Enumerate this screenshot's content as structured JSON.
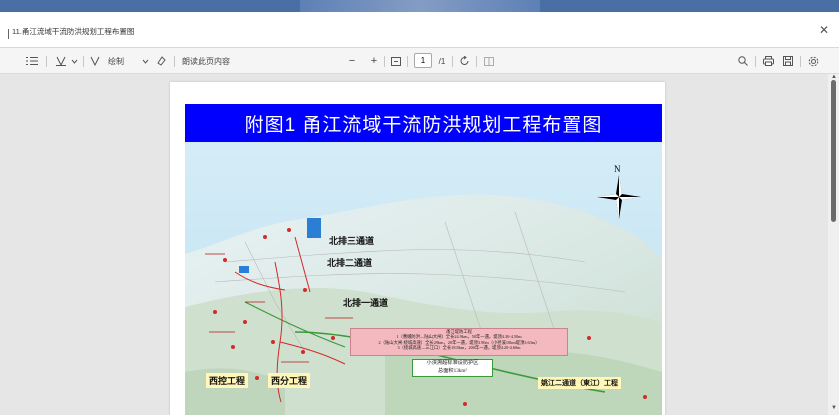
{
  "window": {
    "title": "11.甬江流域干流防洪规划工程布置图"
  },
  "toolbar": {
    "draw_label": "绘制",
    "read_aloud_label": "朗读此页内容",
    "current_page": "1",
    "total_pages": "/1"
  },
  "document": {
    "heading": "附图1  甬江流域干流防洪规划工程布置图",
    "north": "N",
    "channel_labels": {
      "north_3": "北排三通道",
      "north_2": "北排二通道",
      "north_1": "北排一通道",
      "xikong": "西控工程",
      "xifen": "西分工程",
      "yaojiang": "姚江二通道（東江）工程"
    },
    "info_box": {
      "lines": [
        "甬江堤防工程",
        "1（曹娥防洪—陆山大闸）全长24.9km，50年一遇，堤顶4.30-4.50m",
        "2（陆山大闸-绕城高速）全长29km，20年一遇，堤顶3.90m（小径溪10km堤顶3.63m）",
        "3（绕城高速—三江口）全长18.8km，200年一遇，堤顶4.20-4.60m"
      ]
    },
    "green_box": {
      "lines": [
        "小浃溯超标准设防护区",
        "总面积13km²"
      ]
    }
  }
}
